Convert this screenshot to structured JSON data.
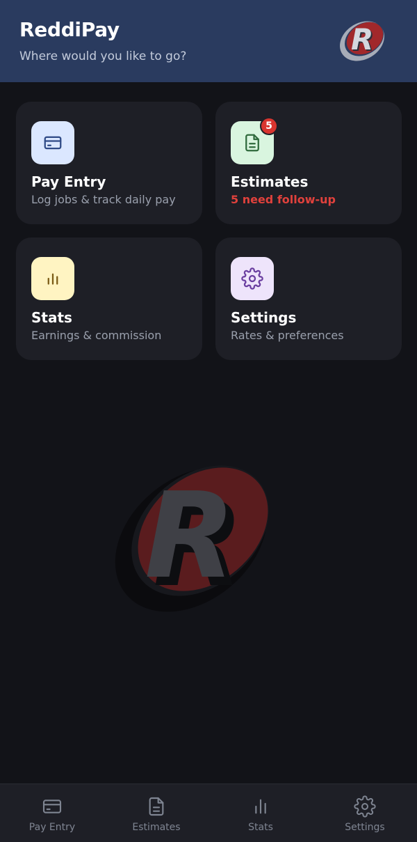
{
  "header": {
    "title": "ReddiPay",
    "subtitle": "Where would you like to go?",
    "logo_icon": "reddipay-logo-icon"
  },
  "cards": [
    {
      "title": "Pay Entry",
      "subtitle": "Log jobs & track daily pay",
      "icon": "credit-card-icon",
      "icon_bg": "#dbe7ff",
      "icon_color": "#2f4a86"
    },
    {
      "title": "Estimates",
      "subtitle": "5 need follow-up",
      "badge": "5",
      "icon": "document-icon",
      "icon_bg": "#d9f5df",
      "icon_color": "#2f6a3c",
      "subtitle_color": "#e0413c"
    },
    {
      "title": "Stats",
      "subtitle": "Earnings & commission",
      "icon": "bar-chart-icon",
      "icon_bg": "#fff4c2",
      "icon_color": "#7a5a14"
    },
    {
      "title": "Settings",
      "subtitle": "Rates & preferences",
      "icon": "gear-icon",
      "icon_bg": "#eee4fb",
      "icon_color": "#6a3ea0"
    }
  ],
  "nav": [
    {
      "label": "Pay Entry",
      "icon": "credit-card-icon"
    },
    {
      "label": "Estimates",
      "icon": "document-icon"
    },
    {
      "label": "Stats",
      "icon": "bar-chart-icon"
    },
    {
      "label": "Settings",
      "icon": "gear-icon"
    }
  ],
  "colors": {
    "header_bg": "#2a3b5f",
    "page_bg": "#121318",
    "card_bg": "#1e1f26",
    "alert": "#e0413c",
    "brand_red": "#9b2c2e"
  }
}
